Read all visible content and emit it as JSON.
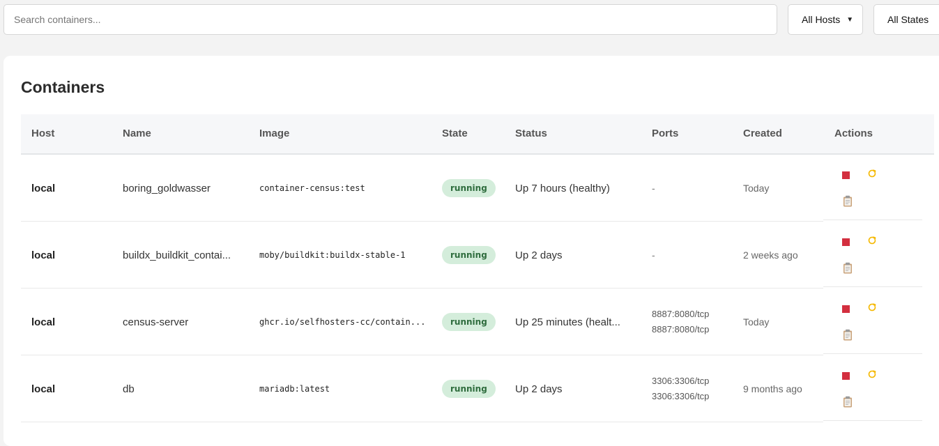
{
  "toolbar": {
    "search_placeholder": "Search containers...",
    "host_filter": {
      "selected": "All Hosts"
    },
    "state_filter": {
      "selected": "All States"
    }
  },
  "main": {
    "title": "Containers",
    "columns": [
      "Host",
      "Name",
      "Image",
      "State",
      "Status",
      "Ports",
      "Created",
      "Actions"
    ],
    "rows": [
      {
        "host": "local",
        "name": "boring_goldwasser",
        "image": "container-census:test",
        "state": "running",
        "status": "Up 7 hours (healthy)",
        "ports": [
          "-"
        ],
        "created": "Today"
      },
      {
        "host": "local",
        "name": "buildx_buildkit_contai...",
        "image": "moby/buildkit:buildx-stable-1",
        "state": "running",
        "status": "Up 2 days",
        "ports": [
          "-"
        ],
        "created": "2 weeks ago"
      },
      {
        "host": "local",
        "name": "census-server",
        "image": "ghcr.io/selfhosters-cc/contain...",
        "state": "running",
        "status": "Up 25 minutes (healt...",
        "ports": [
          "8887:8080/tcp",
          "8887:8080/tcp"
        ],
        "created": "Today"
      },
      {
        "host": "local",
        "name": "db",
        "image": "mariadb:latest",
        "state": "running",
        "status": "Up 2 days",
        "ports": [
          "3306:3306/tcp",
          "3306:3306/tcp"
        ],
        "created": "9 months ago"
      }
    ]
  },
  "colors": {
    "stop": "#d32f3f",
    "restart": "#f5b800",
    "badge_bg": "#d4eddb",
    "badge_text": "#2f6d3e"
  },
  "icons": {
    "stop": "stop-icon",
    "restart": "restart-icon",
    "logs": "clipboard-icon"
  }
}
